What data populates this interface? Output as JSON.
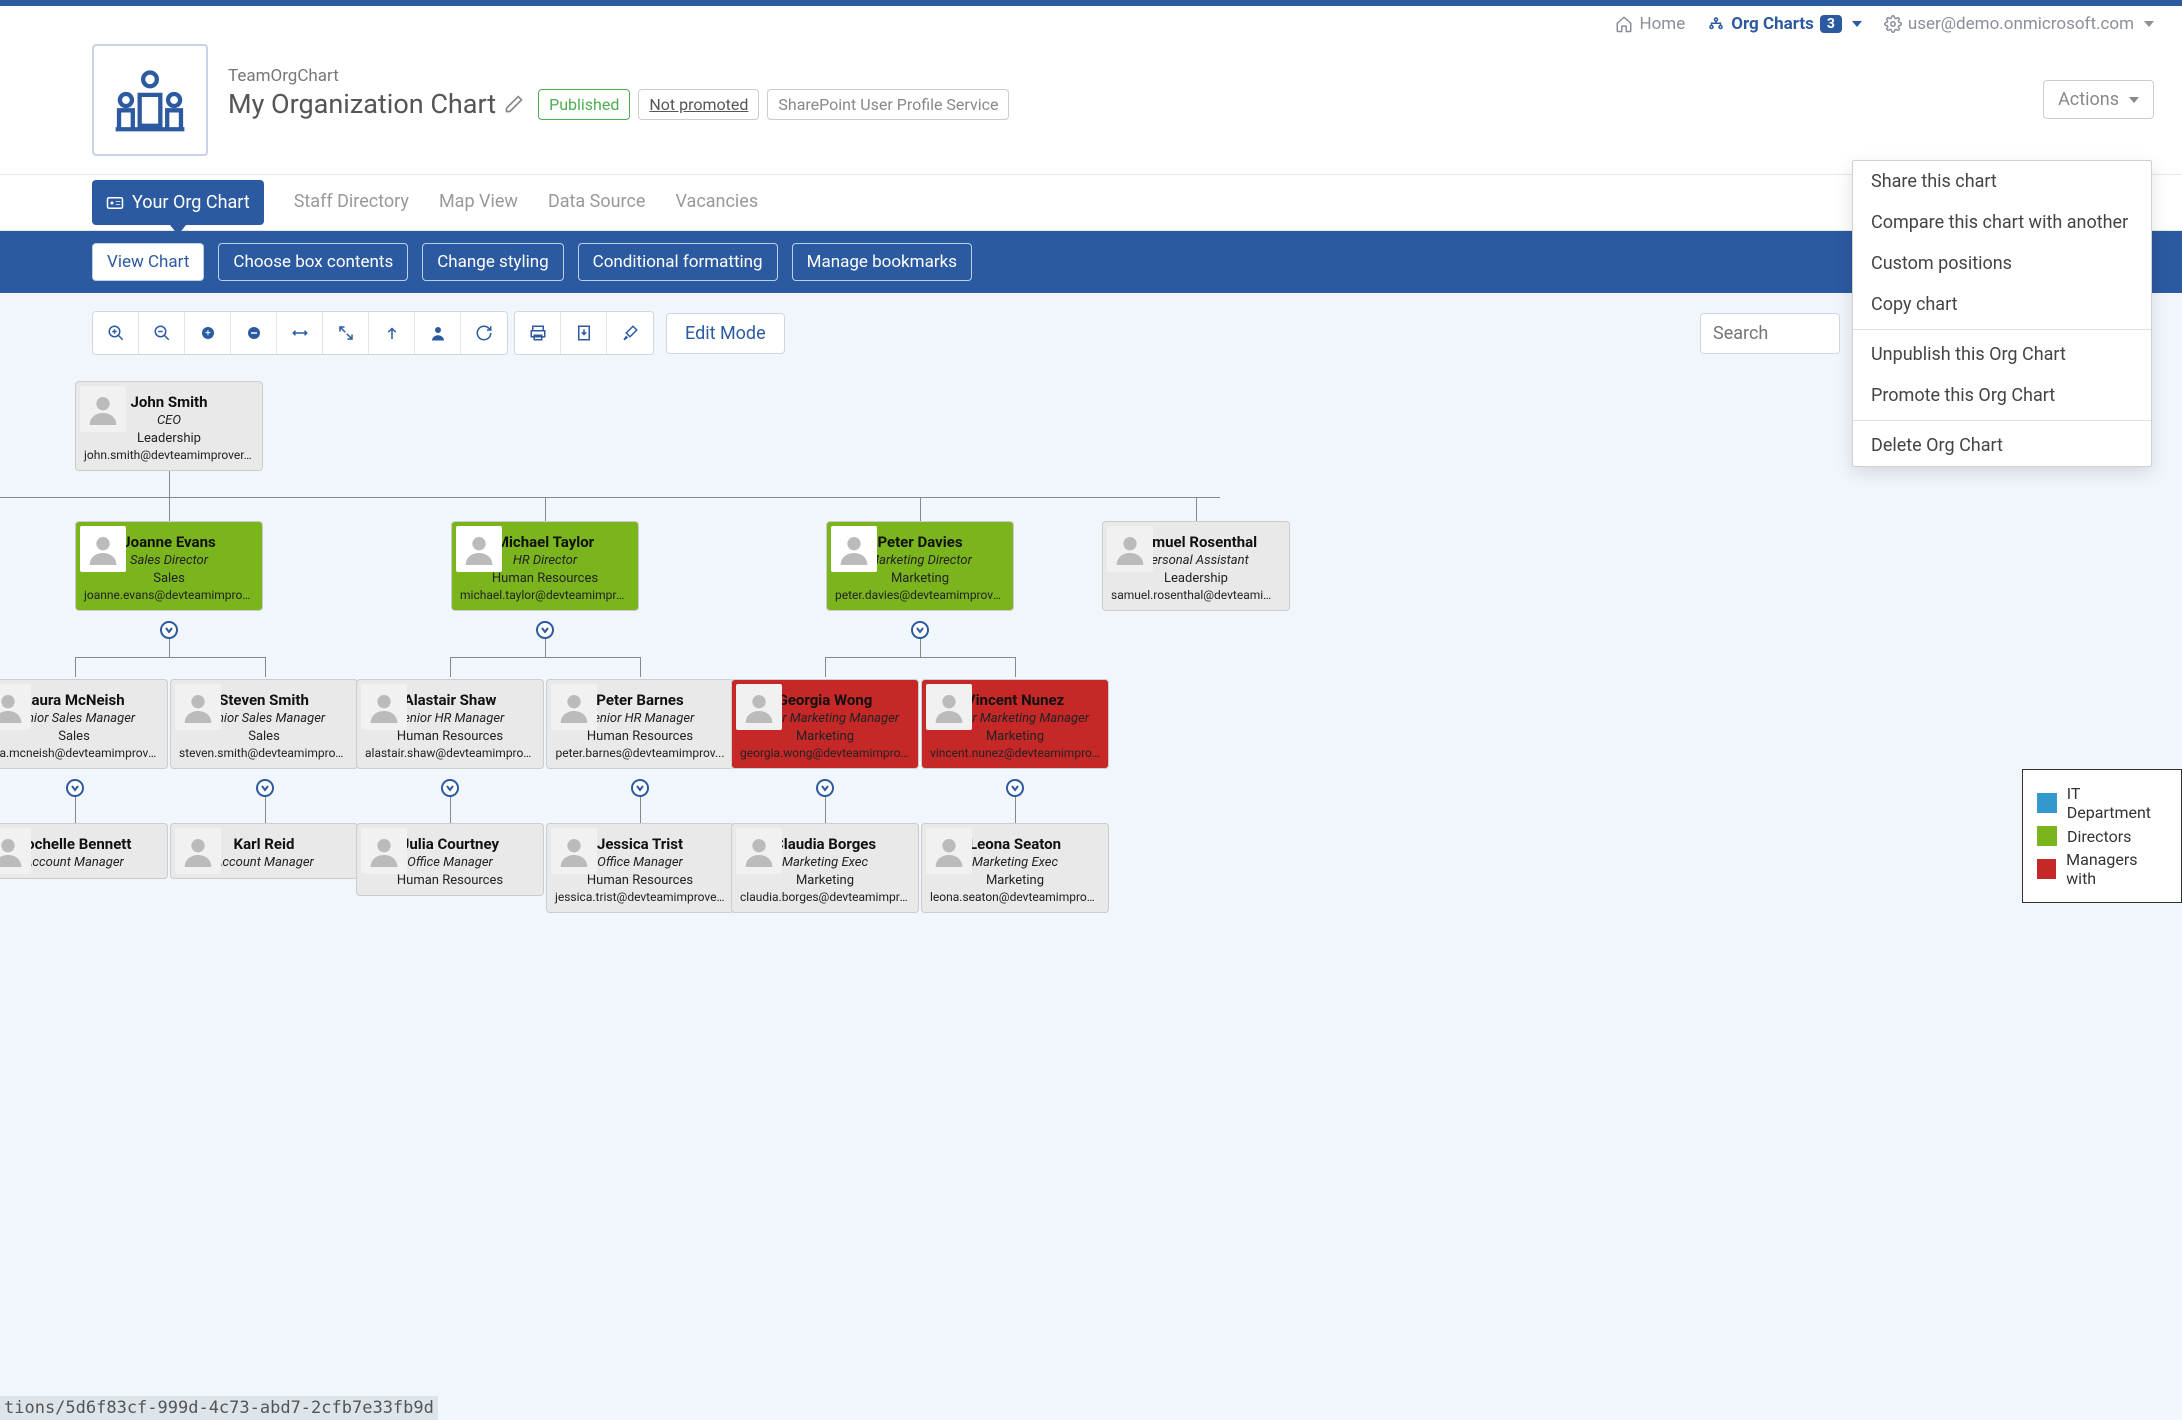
{
  "topnav": {
    "home": "Home",
    "orgcharts_label": "Org Charts",
    "orgcharts_count": "3",
    "user": "user@demo.onmicrosoft.com"
  },
  "header": {
    "product": "TeamOrgChart",
    "title": "My Organization Chart",
    "published": "Published",
    "not_promoted": "Not promoted",
    "service": "SharePoint User Profile Service",
    "actions_label": "Actions"
  },
  "actions_menu": [
    "Share this chart",
    "Compare this chart with another",
    "Custom positions",
    "Copy chart",
    "---",
    "Unpublish this Org Chart",
    "Promote this Org Chart",
    "---",
    "Delete Org Chart"
  ],
  "tabs": [
    "Your Org Chart",
    "Staff Directory",
    "Map View",
    "Data Source",
    "Vacancies"
  ],
  "subtabs": [
    "View Chart",
    "Choose box contents",
    "Change styling",
    "Conditional formatting",
    "Manage bookmarks"
  ],
  "toolbar": {
    "edit_mode": "Edit Mode",
    "search_placeholder": "Search"
  },
  "legend": [
    {
      "color": "#3399cc",
      "label": "IT Department"
    },
    {
      "color": "#7ab51d",
      "label": "Directors"
    },
    {
      "color": "#c62828",
      "label": "Managers with"
    }
  ],
  "nodes": {
    "root": {
      "name": "John Smith",
      "title": "CEO",
      "dept": "Leadership",
      "email": "john.smith@devteamimprover.onm..."
    },
    "l1": [
      {
        "name": "Joanne Evans",
        "title": "Sales Director",
        "dept": "Sales",
        "email": "joanne.evans@devteamimprover.o...",
        "cls": "dir",
        "photo": true
      },
      {
        "name": "Michael Taylor",
        "title": "HR Director",
        "dept": "Human Resources",
        "email": "michael.taylor@devteamimprover...",
        "cls": "dir",
        "photo": true
      },
      {
        "name": "Peter Davies",
        "title": "Marketing Director",
        "dept": "Marketing",
        "email": "peter.davies@devteamimprover.o...",
        "cls": "dir",
        "photo": true
      },
      {
        "name": "Samuel Rosenthal",
        "title": "Personal Assistant",
        "dept": "Leadership",
        "email": "samuel.rosenthal@devteamimprov...",
        "cls": "",
        "photo": false
      }
    ],
    "l2": [
      {
        "name": "Laura McNeish",
        "title": "Senior Sales Manager",
        "dept": "Sales",
        "email": "ura.mcneish@devteamimprover...."
      },
      {
        "name": "Steven Smith",
        "title": "Senior Sales Manager",
        "dept": "Sales",
        "email": "steven.smith@devteamimprover...."
      },
      {
        "name": "Alastair Shaw",
        "title": "Senior HR Manager",
        "dept": "Human Resources",
        "email": "alastair.shaw@devteamimprover...."
      },
      {
        "name": "Peter Barnes",
        "title": "Senior HR Manager",
        "dept": "Human Resources",
        "email": "peter.barnes@devteamimprov..."
      },
      {
        "name": "Georgia Wong",
        "title": "Senior Marketing Manager",
        "dept": "Marketing",
        "email": "georgia.wong@devteamimprover.o...",
        "cls": "mgr"
      },
      {
        "name": "Vincent Nunez",
        "title": "Senior Marketing Manager",
        "dept": "Marketing",
        "email": "vincent.nunez@devteamimprover...",
        "cls": "mgr"
      }
    ],
    "l3": [
      {
        "name": "Rochelle Bennett",
        "title": "Account Manager",
        "dept": ""
      },
      {
        "name": "Karl Reid",
        "title": "Account Manager",
        "dept": ""
      },
      {
        "name": "Julia Courtney",
        "title": "Office Manager",
        "dept": "Human Resources"
      },
      {
        "name": "Jessica Trist",
        "title": "Office Manager",
        "dept": "Human Resources",
        "email": "jessica.trist@devteamimprover.o"
      },
      {
        "name": "Claudia Borges",
        "title": "Marketing Exec",
        "dept": "Marketing",
        "email": "claudia.borges@devteamimprover"
      },
      {
        "name": "Leona Seaton",
        "title": "Marketing Exec",
        "dept": "Marketing",
        "email": "leona.seaton@devteamimprover.o"
      }
    ]
  },
  "url_fragment": "tions/5d6f83cf-999d-4c73-abd7-2cfb7e33fb9d"
}
